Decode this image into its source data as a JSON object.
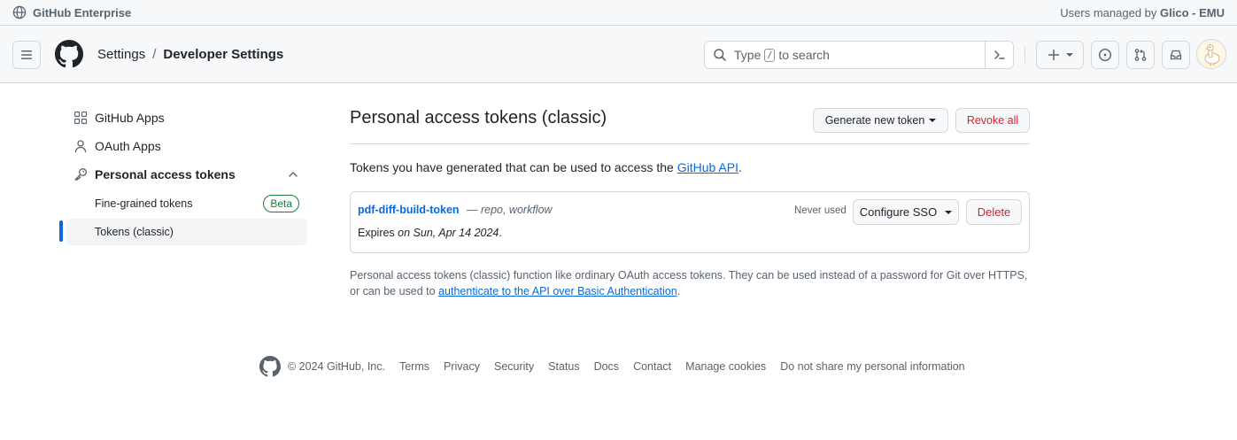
{
  "enterprise_bar": {
    "label": "GitHub Enterprise",
    "managed_prefix": "Users managed by",
    "managed_org": "Glico - EMU"
  },
  "header": {
    "breadcrumb_root": "Settings",
    "breadcrumb_sep": "/",
    "breadcrumb_current": "Developer Settings",
    "search_prefix": "Type",
    "search_key": "/",
    "search_suffix": "to search"
  },
  "sidebar": {
    "items": [
      {
        "label": "GitHub Apps",
        "icon": "apps-icon"
      },
      {
        "label": "OAuth Apps",
        "icon": "person-icon"
      },
      {
        "label": "Personal access tokens",
        "icon": "key-icon"
      }
    ],
    "sub_items": [
      {
        "label": "Fine-grained tokens",
        "badge": "Beta"
      },
      {
        "label": "Tokens (classic)"
      }
    ]
  },
  "main": {
    "title": "Personal access tokens (classic)",
    "generate_label": "Generate new token",
    "revoke_label": "Revoke all",
    "intro_text": "Tokens you have generated that can be used to access the",
    "intro_link": "GitHub API",
    "intro_end": ".",
    "token": {
      "name": "pdf-diff-build-token",
      "scopes": "— repo, workflow",
      "expires_prefix": "Expires",
      "expires_date": "on Sun, Apr 14 2024",
      "expires_end": ".",
      "last_used": "Never used",
      "configure_label": "Configure SSO",
      "delete_label": "Delete"
    },
    "footnote_text": "Personal access tokens (classic) function like ordinary OAuth access tokens. They can be used instead of a password for Git over HTTPS, or can be used to",
    "footnote_link": "authenticate to the API over Basic Authentication",
    "footnote_end": "."
  },
  "footer": {
    "copyright": "© 2024 GitHub, Inc.",
    "links": [
      "Terms",
      "Privacy",
      "Security",
      "Status",
      "Docs",
      "Contact",
      "Manage cookies",
      "Do not share my personal information"
    ]
  },
  "colors": {
    "accent": "#0969da",
    "danger": "#d1242f",
    "success": "#1a7f37"
  }
}
